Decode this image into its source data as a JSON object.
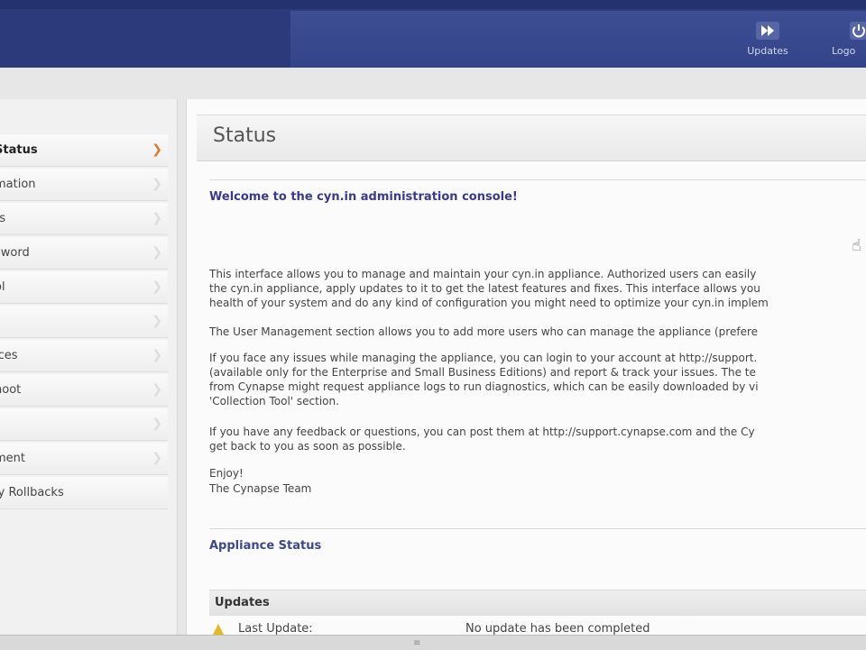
{
  "header": {
    "updates_label": "Updates",
    "logout_label": "Logo"
  },
  "sidebar": {
    "items": [
      {
        "label": "Status"
      },
      {
        "label": "mation"
      },
      {
        "label": "rs"
      },
      {
        "label": "sword"
      },
      {
        "label": "ol"
      },
      {
        "label": ""
      },
      {
        "label": "ices"
      },
      {
        "label": "noot"
      },
      {
        "label": ""
      },
      {
        "label": "ment"
      },
      {
        "label": "ly Rollbacks"
      }
    ]
  },
  "main": {
    "title": "Status",
    "welcome": "Welcome to the cyn.in administration console!",
    "para1_line1": "This interface allows you to manage and maintain your cyn.in appliance. Authorized users can easily",
    "para1_line2": "the cyn.in appliance, apply updates to it to get the latest features and fixes. This interface allows you",
    "para1_line3": "health of your system and do any kind of configuration you might need to optimize your cyn.in implem",
    "para2": "The User Management section allows you to add more users who can manage the appliance (prefere",
    "para3_line1": "If you face any issues while managing the appliance, you can login to your account at http://support.",
    "para3_line2": "(available only for the Enterprise and Small Business Editions) and report & track your issues. The te",
    "para3_line3": "from Cynapse might request appliance logs to run diagnostics, which can be easily downloaded by vi",
    "para3_line4": "'Collection Tool' section.",
    "para4_line1": "If you have any feedback or questions, you can post them at http://support.cynapse.com and the Cy",
    "para4_line2": "get back to you as soon as possible.",
    "signoff1": "Enjoy!",
    "signoff2": "The Cynapse Team",
    "appliance_status": "Appliance Status",
    "updates_heading": "Updates",
    "last_update_label": "Last Update:",
    "last_update_value": "No update has been completed"
  },
  "colors": {
    "header": "#2c3a7c",
    "accent_arrow": "#e07a2a",
    "link_heading": "#3a3a8c"
  }
}
